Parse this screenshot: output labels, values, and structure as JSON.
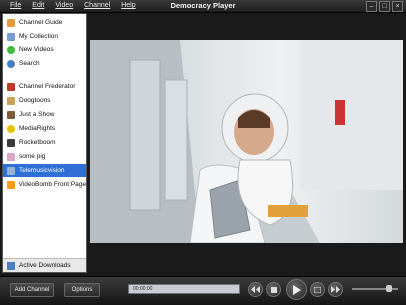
{
  "app": {
    "title": "Democracy Player"
  },
  "menu": [
    "File",
    "Edit",
    "Video",
    "Channel",
    "Help"
  ],
  "sidebar": {
    "items": [
      {
        "label": "Channel Guide",
        "icon": "channel-guide-icon",
        "color": "#e39b3b"
      },
      {
        "label": "My Collection",
        "icon": "collection-icon",
        "color": "#7a9ccf"
      },
      {
        "label": "New Videos",
        "icon": "new-videos-icon",
        "color": "#3cba38"
      },
      {
        "label": "Search",
        "icon": "search-icon",
        "color": "#4a7fbf"
      },
      {
        "label": "Channel Frederator",
        "icon": "channel-thumb-icon",
        "color": "#c0392b"
      },
      {
        "label": "Doogtoons",
        "icon": "channel-thumb-icon",
        "color": "#c9a25a"
      },
      {
        "label": "Just a Show",
        "icon": "channel-thumb-icon",
        "color": "#7d5c3a"
      },
      {
        "label": "MediaRights",
        "icon": "channel-thumb-icon",
        "color": "#e5c400"
      },
      {
        "label": "Rocketboom",
        "icon": "channel-thumb-icon",
        "color": "#3a3a3a"
      },
      {
        "label": "some pig",
        "icon": "channel-thumb-icon",
        "color": "#d9a7c7"
      },
      {
        "label": "Telemusicvision",
        "icon": "channel-thumb-icon",
        "color": "#9ab2d6"
      },
      {
        "label": "VideoBomb Front Page",
        "icon": "rss-icon",
        "color": "#f39c12"
      }
    ],
    "selected_index": 10,
    "bottom": "Active Downloads"
  },
  "controls": {
    "add_channel": "Add Channel",
    "options": "Options",
    "time": "00:00:00"
  },
  "colors": {
    "accent": "#2f6fd6",
    "chrome": "#1e1e1e"
  }
}
